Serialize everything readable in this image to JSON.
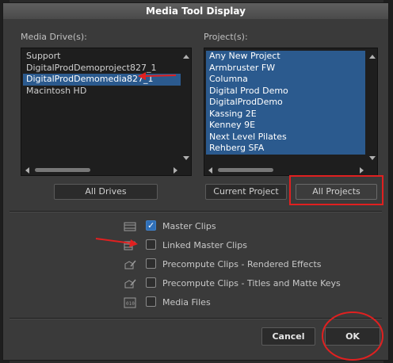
{
  "dialog": {
    "title": "Media Tool Display"
  },
  "media_drives": {
    "label": "Media Drive(s):",
    "items": [
      {
        "label": "Support",
        "selected": false
      },
      {
        "label": "DigitalProdDemoproject827_1",
        "selected": false
      },
      {
        "label": "DigitalProdDemomedia827_1",
        "selected": true
      },
      {
        "label": "Macintosh HD",
        "selected": false
      }
    ],
    "button_label": "All Drives"
  },
  "projects": {
    "label": "Project(s):",
    "items": [
      {
        "label": "Any New Project",
        "selected": true
      },
      {
        "label": "Armbruster FW",
        "selected": true
      },
      {
        "label": "Columna",
        "selected": true
      },
      {
        "label": "Digital Prod Demo",
        "selected": true
      },
      {
        "label": "DigitalProdDemo",
        "selected": true
      },
      {
        "label": "Kassing 2E",
        "selected": true
      },
      {
        "label": "Kenney 9E",
        "selected": true
      },
      {
        "label": "Next Level Pilates",
        "selected": true
      },
      {
        "label": "Rehberg SFA",
        "selected": true
      }
    ],
    "current_button_label": "Current Project",
    "all_button_label": "All Projects"
  },
  "options": [
    {
      "label": "Master Clips",
      "checked": true,
      "icon": "master-clip-icon"
    },
    {
      "label": "Linked Master Clips",
      "checked": false,
      "icon": "linked-clip-icon"
    },
    {
      "label": "Precompute Clips - Rendered Effects",
      "checked": false,
      "icon": "precompute-effects-icon"
    },
    {
      "label": "Precompute Clips - Titles and Matte Keys",
      "checked": false,
      "icon": "precompute-titles-icon"
    },
    {
      "label": "Media Files",
      "checked": false,
      "icon": "media-file-icon"
    }
  ],
  "footer": {
    "cancel_label": "Cancel",
    "ok_label": "OK"
  },
  "colors": {
    "annotation": "#e02020",
    "selection": "#2b5a8e",
    "checkbox_checked": "#2f6fb8"
  }
}
